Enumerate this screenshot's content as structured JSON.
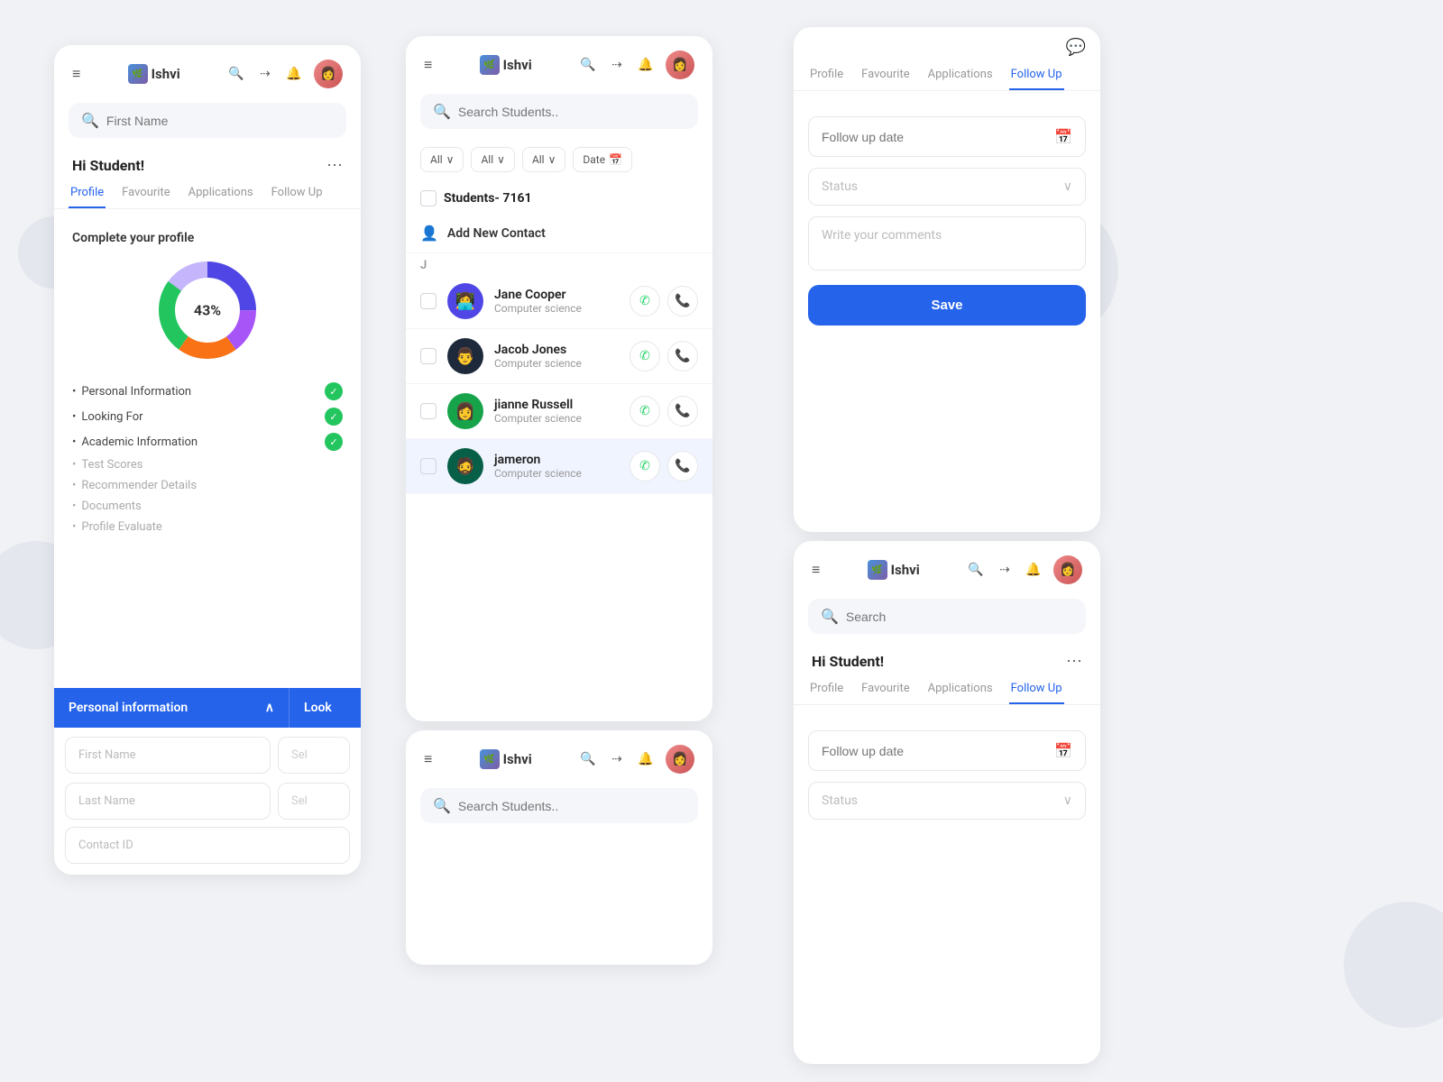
{
  "bg": {
    "color": "#f0f2f5"
  },
  "brand": {
    "name": "Ishvi",
    "accent": "#2563eb"
  },
  "card1": {
    "greeting": "Hi Student!",
    "profileTitle": "Complete your profile",
    "donutPercent": "43%",
    "navTabs": [
      "Profile",
      "Favourite",
      "Applications",
      "Follow Up"
    ],
    "activeTab": "Profile",
    "checkItems": [
      {
        "label": "Personal Information",
        "done": true
      },
      {
        "label": "Looking For",
        "done": true
      },
      {
        "label": "Academic Information",
        "done": true
      },
      {
        "label": "Test Scores",
        "done": false
      },
      {
        "label": "Recommender Details",
        "done": false
      },
      {
        "label": "Documents",
        "done": false
      },
      {
        "label": "Profile Evaluate",
        "done": false
      }
    ],
    "accordion": {
      "label1": "Personal information",
      "label2": "Look",
      "fields": [
        "First Name",
        "Last Name",
        "Contact ID"
      ]
    }
  },
  "card2": {
    "searchPlaceholder": "Search Students..",
    "filters": [
      "All",
      "All",
      "All"
    ],
    "dateLabel": "Date",
    "studentsCount": "Students- 7161",
    "addContact": "Add New Contact",
    "sectionLetter": "J",
    "students": [
      {
        "name": "Jane Cooper",
        "subject": "Computer science",
        "avatar": "🧑",
        "avatarBg": "#4f46e5"
      },
      {
        "name": "Jacob Jones",
        "subject": "Computer science",
        "avatar": "👨",
        "avatarBg": "#1e293b"
      },
      {
        "name": "jianne Russell",
        "subject": "Computer science",
        "avatar": "👩",
        "avatarBg": "#16a34a"
      },
      {
        "name": "jameron",
        "subject": "Computer science",
        "avatar": "🧔",
        "avatarBg": "#065f46"
      }
    ]
  },
  "card3": {
    "navTabs": [
      "Profile",
      "Favourite",
      "Applications",
      "Follow Up"
    ],
    "activeTab": "Follow Up",
    "followUpDatePlaceholder": "Follow up date",
    "statusPlaceholder": "Status",
    "commentPlaceholder": "Write your comments",
    "saveLabel": "Save"
  },
  "card4": {
    "greeting": "Hi Student!",
    "navTabs": [
      "Profile",
      "Favourite",
      "Applications",
      "Follow Up"
    ],
    "activeTab": "Follow Up",
    "searchPlaceholder": "Search",
    "followUpDatePlaceholder": "Follow up date",
    "statusPlaceholder": "Status"
  },
  "card5": {
    "searchPlaceholder": "Search Students.."
  },
  "icons": {
    "hamburger": "≡",
    "search": "🔍",
    "share": "⇢",
    "bell": "🔔",
    "calendar": "📅",
    "chevronDown": "∨",
    "addUser": "👤+",
    "chat": "💬",
    "whatsapp": "✆",
    "call": "📞",
    "checkmark": "✓",
    "chevronUp": "∧"
  }
}
